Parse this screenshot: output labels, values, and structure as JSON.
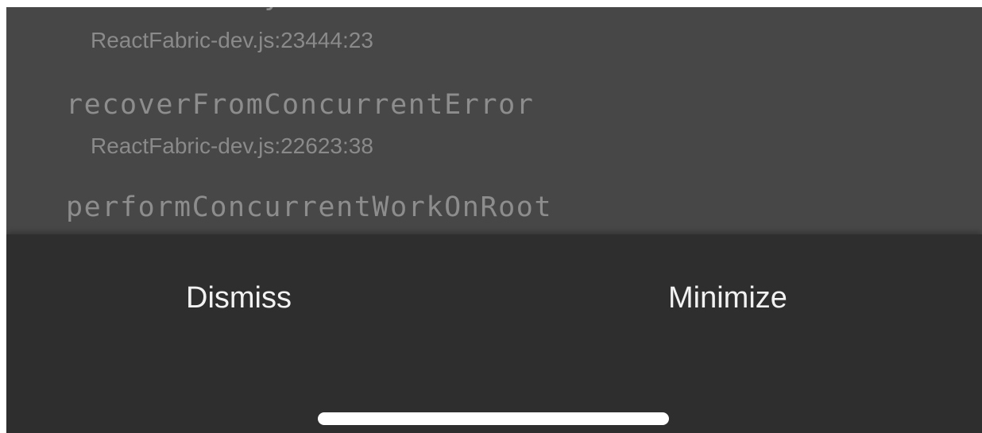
{
  "stack": {
    "frames": [
      {
        "function": "renderRootSync",
        "location": "ReactFabric-dev.js:23444:23"
      },
      {
        "function": "recoverFromConcurrentError",
        "location": "ReactFabric-dev.js:22623:38"
      },
      {
        "function": "performConcurrentWorkOnRoot",
        "location": ""
      }
    ]
  },
  "footer": {
    "dismiss_label": "Dismiss",
    "minimize_label": "Minimize"
  },
  "colors": {
    "stack_background": "#474747",
    "footer_background": "#2e2e2e",
    "function_text": "#8d8d8d",
    "location_text": "#8a8a8a",
    "button_text": "#f2f2f2",
    "home_indicator": "#ffffff"
  }
}
